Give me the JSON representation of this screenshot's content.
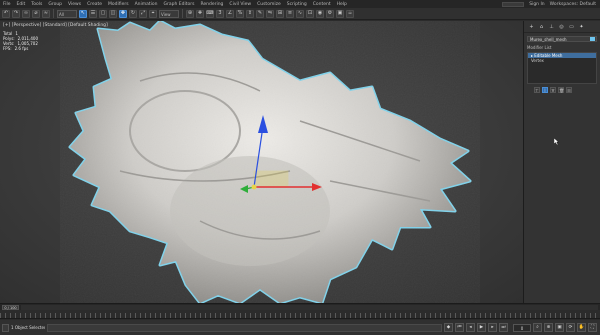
{
  "menubar": {
    "items": [
      "File",
      "Edit",
      "Tools",
      "Group",
      "Views",
      "Create",
      "Modifiers",
      "Animation",
      "Graph Editors",
      "Rendering",
      "Civil View",
      "Customize",
      "Scripting",
      "Content",
      "Help"
    ],
    "workspace_label": "Workspaces: Default",
    "user_label": "Sign In"
  },
  "toolbar": {
    "buttons": [
      {
        "name": "undo-icon",
        "glyph": "↶"
      },
      {
        "name": "redo-icon",
        "glyph": "↷"
      },
      {
        "name": "link-icon",
        "glyph": "∞"
      },
      {
        "name": "unlink-icon",
        "glyph": "⌀"
      },
      {
        "name": "bind-spacewarp-icon",
        "glyph": "≈"
      }
    ],
    "filter_select": "All",
    "tools": [
      {
        "name": "select-object-icon",
        "glyph": "↖",
        "active": true
      },
      {
        "name": "select-by-name-icon",
        "glyph": "☰"
      },
      {
        "name": "rect-region-icon",
        "glyph": "▢"
      },
      {
        "name": "window-crossing-icon",
        "glyph": "◫"
      },
      {
        "name": "move-icon",
        "glyph": "✥",
        "active": true
      },
      {
        "name": "rotate-icon",
        "glyph": "↻"
      },
      {
        "name": "scale-icon",
        "glyph": "⤢"
      },
      {
        "name": "place-icon",
        "glyph": "⌖"
      }
    ],
    "coord_select": "View",
    "extra": [
      {
        "name": "pivot-icon",
        "glyph": "⊕"
      },
      {
        "name": "select-manipulate-icon",
        "glyph": "✚"
      },
      {
        "name": "keyboard-shortcut-icon",
        "glyph": "⌨"
      },
      {
        "name": "snap-toggle-icon",
        "glyph": "3"
      },
      {
        "name": "angle-snap-icon",
        "glyph": "∠"
      },
      {
        "name": "percent-snap-icon",
        "glyph": "%"
      },
      {
        "name": "spinner-snap-icon",
        "glyph": "⇕"
      },
      {
        "name": "named-selection-icon",
        "glyph": "✎"
      },
      {
        "name": "mirror-icon",
        "glyph": "⇋"
      },
      {
        "name": "align-icon",
        "glyph": "⊞"
      },
      {
        "name": "layer-explorer-icon",
        "glyph": "≡"
      },
      {
        "name": "curve-editor-icon",
        "glyph": "∿"
      },
      {
        "name": "schematic-icon",
        "glyph": "⊡"
      },
      {
        "name": "material-editor-icon",
        "glyph": "◉"
      },
      {
        "name": "render-setup-icon",
        "glyph": "⚙"
      },
      {
        "name": "render-frame-icon",
        "glyph": "▣"
      },
      {
        "name": "render-icon",
        "glyph": "☕"
      }
    ]
  },
  "viewport": {
    "label": "[+] [Perspective] [Standard] [Default Shading]",
    "stats": [
      {
        "label": "Total",
        "value": "1"
      },
      {
        "label": "Polys:",
        "value": "2,011,400"
      },
      {
        "label": "Verts:",
        "value": "1,005,702"
      },
      {
        "label": "FPS:",
        "value": "2.6 fps"
      }
    ],
    "colors": {
      "shell": "#d8d6d2",
      "shell_shadow": "#8e8c88",
      "outline": "#7fd3ec",
      "gizmo_x": "#e23030",
      "gizmo_y": "#2fae3a",
      "gizmo_z": "#2a4fe0",
      "gizmo_plane": "#e8d34a"
    }
  },
  "command_panel": {
    "tabs": [
      {
        "name": "create-tab-icon",
        "glyph": "+"
      },
      {
        "name": "modify-tab-icon",
        "glyph": "⌂"
      },
      {
        "name": "hierarchy-tab-icon",
        "glyph": "⊥"
      },
      {
        "name": "motion-tab-icon",
        "glyph": "◎"
      },
      {
        "name": "display-tab-icon",
        "glyph": "▭"
      },
      {
        "name": "utilities-tab-icon",
        "glyph": "✦"
      }
    ],
    "object_name": "Murex_shell_mesh",
    "modifier_list_label": "Modifier List",
    "stack_items": [
      {
        "label": "▸ Editable Mesh",
        "selected": true
      },
      {
        "label": "   Vertex",
        "selected": false
      }
    ],
    "stack_tools": [
      {
        "name": "pin-stack-icon",
        "glyph": "⊤",
        "on": false
      },
      {
        "name": "show-end-result-icon",
        "glyph": "I",
        "on": true
      },
      {
        "name": "make-unique-icon",
        "glyph": "∀",
        "on": false
      },
      {
        "name": "remove-modifier-icon",
        "glyph": "🗑",
        "on": false
      },
      {
        "name": "configure-sets-icon",
        "glyph": "☷",
        "on": false
      }
    ]
  },
  "timeslider": {
    "counter": "0 / 100"
  },
  "statusbar": {
    "selection_text": "1 Object Selected",
    "transport": [
      {
        "name": "auto-key-button",
        "glyph": "◆",
        "active": false
      },
      {
        "name": "go-to-start-icon",
        "glyph": "⏮",
        "active": false
      },
      {
        "name": "prev-frame-icon",
        "glyph": "◂",
        "active": false
      },
      {
        "name": "play-icon",
        "glyph": "▶",
        "active": false
      },
      {
        "name": "next-frame-icon",
        "glyph": "▸",
        "active": false
      },
      {
        "name": "go-to-end-icon",
        "glyph": "⏭",
        "active": false
      }
    ],
    "frame_value": "0",
    "nav": [
      {
        "name": "zoom-icon",
        "glyph": "⌕"
      },
      {
        "name": "zoom-all-icon",
        "glyph": "⊕"
      },
      {
        "name": "zoom-extents-icon",
        "glyph": "▣"
      },
      {
        "name": "orbit-icon",
        "glyph": "⟳"
      },
      {
        "name": "pan-icon",
        "glyph": "✋"
      },
      {
        "name": "maximize-viewport-icon",
        "glyph": "⛶"
      }
    ]
  }
}
